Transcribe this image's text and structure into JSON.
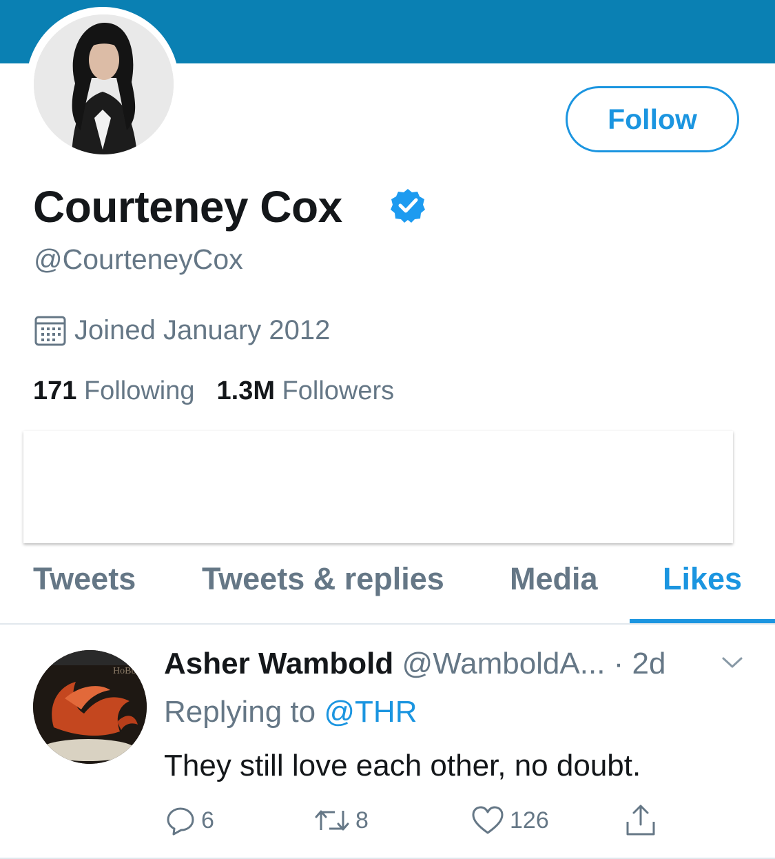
{
  "profile": {
    "display_name": "Courteney Cox",
    "handle": "@CourteneyCox",
    "joined": "Joined January 2012",
    "following_count": "171",
    "following_label": "Following",
    "followers_count": "1.3M",
    "followers_label": "Followers",
    "follow_button": "Follow",
    "verified": true
  },
  "tabs": [
    {
      "label": "Tweets",
      "active": false
    },
    {
      "label": "Tweets & replies",
      "active": false
    },
    {
      "label": "Media",
      "active": false
    },
    {
      "label": "Likes",
      "active": true
    }
  ],
  "tweet": {
    "author_name": "Asher Wambold",
    "author_handle": "@WamboldA...",
    "time": "· 2d",
    "replying_prefix": "Replying to",
    "replying_to": "@THR",
    "text": "They still love each other, no doubt.",
    "avatar_text": "HoBb",
    "reply_count": "6",
    "retweet_count": "8",
    "like_count": "126"
  },
  "colors": {
    "banner": "#0a80b3",
    "accent": "#1b95e0",
    "secondary_text": "#657786",
    "primary_text": "#14171a"
  }
}
